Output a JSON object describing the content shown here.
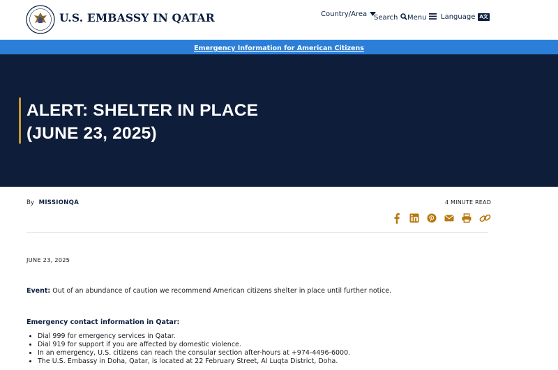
{
  "header": {
    "site_title": "U.S. EMBASSY IN QATAR",
    "nav": {
      "country": "Country/Area",
      "search": "Search",
      "menu": "Menu",
      "language": "Language",
      "language_badge": "A文"
    }
  },
  "emergency_bar": {
    "link_text": "Emergency Information for American Citizens"
  },
  "hero": {
    "title_line1": "ALERT: SHELTER IN PLACE",
    "title_line2": "(JUNE 23, 2025)"
  },
  "meta": {
    "by_label": "By",
    "author": "MISSIONQA",
    "read_time": "4 MINUTE READ",
    "share_icons": [
      "facebook-icon",
      "linkedin-icon",
      "pinterest-icon",
      "email-icon",
      "print-icon",
      "copy-link-icon"
    ]
  },
  "article": {
    "date": "JUNE 23, 2025",
    "event_label": "Event:",
    "event_text": " Out of an abundance of caution we recommend American citizens shelter in place until further notice.",
    "contact_heading": "Emergency contact information in Qatar:",
    "contact_items": [
      "Dial 999 for emergency services in Qatar.",
      "Dial 919 for support if you are affected by domestic violence.",
      "In an emergency, U.S. citizens can reach the consular section after-hours at +974-4496-6000.",
      "The U.S. Embassy in Doha, Qatar, is located at 22 February Street, Al Luqta District, Doha."
    ]
  },
  "colors": {
    "navy": "#0e1d3a",
    "title_navy": "#0b1f3f",
    "emergency_blue": "#2b7fd8",
    "accent_gold": "#c99a2e",
    "share_icon_color": "#b8780f"
  }
}
